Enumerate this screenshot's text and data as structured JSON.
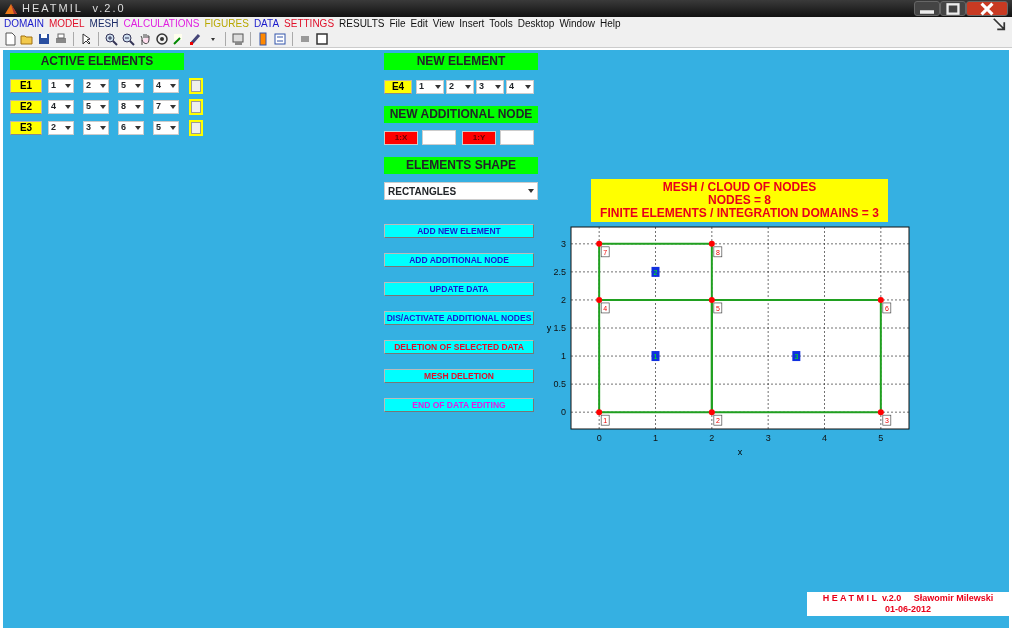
{
  "window": {
    "title": "HEATMIL  v.2.0"
  },
  "menu": [
    {
      "label": "DOMAIN",
      "color": "#1a1acc"
    },
    {
      "label": "MODEL",
      "color": "#e0102a"
    },
    {
      "label": "MESH",
      "color": "#1a2a66"
    },
    {
      "label": "CALCULATIONS",
      "color": "#e020e0"
    },
    {
      "label": "FIGURES",
      "color": "#b8a800"
    },
    {
      "label": "DATA",
      "color": "#1a1acc"
    },
    {
      "label": "SETTINGS",
      "color": "#e0102a"
    },
    {
      "label": "RESULTS",
      "color": "#111111"
    },
    {
      "label": "File",
      "color": "#111111"
    },
    {
      "label": "Edit",
      "color": "#111111"
    },
    {
      "label": "View",
      "color": "#111111"
    },
    {
      "label": "Insert",
      "color": "#111111"
    },
    {
      "label": "Tools",
      "color": "#111111"
    },
    {
      "label": "Desktop",
      "color": "#111111"
    },
    {
      "label": "Window",
      "color": "#111111"
    },
    {
      "label": "Help",
      "color": "#111111"
    }
  ],
  "active_elements": {
    "title": "ACTIVE ELEMENTS",
    "rows": [
      {
        "label": "E1",
        "nodes": [
          "1",
          "2",
          "5",
          "4"
        ],
        "checked": false
      },
      {
        "label": "E2",
        "nodes": [
          "4",
          "5",
          "8",
          "7"
        ],
        "checked": false
      },
      {
        "label": "E3",
        "nodes": [
          "2",
          "3",
          "6",
          "5"
        ],
        "checked": false
      }
    ]
  },
  "new_element": {
    "title": "NEW ELEMENT",
    "label": "E4",
    "nodes": [
      "1",
      "2",
      "3",
      "4"
    ]
  },
  "new_additional_node": {
    "title": "NEW ADDITIONAL NODE",
    "x_label": "1:X",
    "y_label": "1:Y"
  },
  "elements_shape": {
    "title": "ELEMENTS SHAPE",
    "value": "RECTANGLES"
  },
  "actions": [
    {
      "label": "ADD NEW ELEMENT",
      "kind": "edit"
    },
    {
      "label": "ADD ADDITIONAL NODE",
      "kind": "edit"
    },
    {
      "label": "UPDATE DATA",
      "kind": "edit"
    },
    {
      "label": "DIS/ACTIVATE ADDITIONAL NODES",
      "kind": "edit"
    },
    {
      "label": "DELETION OF SELECTED DATA",
      "kind": "delete"
    },
    {
      "label": "MESH DELETION",
      "kind": "delete"
    },
    {
      "label": "END OF DATA EDITING",
      "kind": "finish"
    }
  ],
  "plot": {
    "title_lines": [
      "MESH / CLOUD OF NODES",
      "NODES = 8",
      "FINITE ELEMENTS / INTEGRATION DOMAINS = 3"
    ],
    "element_labels": [
      "1",
      "2",
      "3"
    ],
    "chart_data": {
      "type": "scatter",
      "grid": true,
      "xlabel": "x",
      "ylabel": "y",
      "xlim": [
        -0.5,
        5.5
      ],
      "ylim": [
        -0.3,
        3.3
      ],
      "xticks": [
        0,
        1,
        2,
        3,
        4,
        5
      ],
      "yticks": [
        0,
        0.5,
        1,
        1.5,
        2,
        2.5,
        3
      ],
      "series": [
        {
          "color": "#ff0000",
          "x": [
            0,
            2,
            5,
            0,
            2,
            5,
            0,
            2
          ],
          "values": [
            0,
            0,
            0,
            2,
            2,
            2,
            3,
            3
          ]
        }
      ],
      "annotations": [
        {
          "text": "1",
          "x": 0,
          "y": 0
        },
        {
          "text": "2",
          "x": 2,
          "y": 0
        },
        {
          "text": "3",
          "x": 5,
          "y": 0
        },
        {
          "text": "4",
          "x": 0,
          "y": 2
        },
        {
          "text": "5",
          "x": 2,
          "y": 2
        },
        {
          "text": "6",
          "x": 5,
          "y": 2
        },
        {
          "text": "7",
          "x": 0,
          "y": 3
        },
        {
          "text": "8",
          "x": 2,
          "y": 3
        }
      ]
    }
  },
  "credit": {
    "line1": "H E A T M I L  v.2.0     Sławomir Milewski",
    "line2": "01-06-2012"
  }
}
